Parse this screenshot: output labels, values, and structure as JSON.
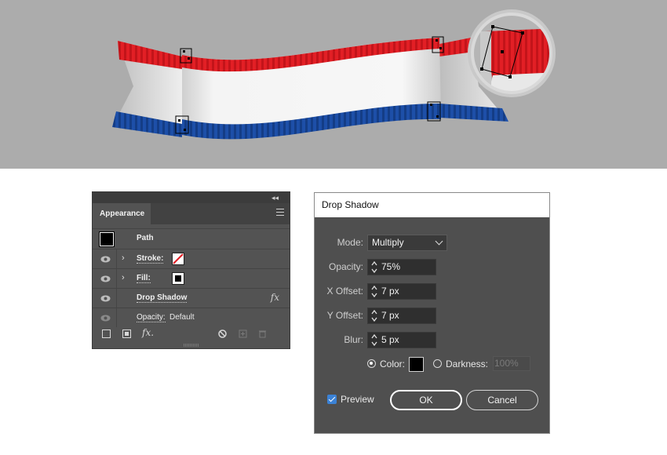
{
  "appearance": {
    "tab_label": "Appearance",
    "path_label": "Path",
    "stroke_label": "Stroke:",
    "fill_label": "Fill:",
    "drop_shadow_label": "Drop Shadow",
    "fx_glyph": "fx",
    "opacity_label": "Opacity:",
    "opacity_value": "Default",
    "collapse_glyph": "◂◂",
    "close_glyph": "✕",
    "toolbar_fx": "fx."
  },
  "drop_shadow": {
    "title": "Drop Shadow",
    "mode_label": "Mode:",
    "mode_value": "Multiply",
    "opacity_label": "Opacity:",
    "opacity_value": "75%",
    "x_offset_label": "X Offset:",
    "x_offset_value": "7 px",
    "y_offset_label": "Y Offset:",
    "y_offset_value": "7 px",
    "blur_label": "Blur:",
    "blur_value": "5 px",
    "color_label": "Color:",
    "color_value": "#000000",
    "darkness_label": "Darkness:",
    "darkness_value": "100%",
    "preview_label": "Preview",
    "ok_label": "OK",
    "cancel_label": "Cancel"
  },
  "colors": {
    "ribbon_red": "#e21f25",
    "ribbon_white": "#f4f4f4",
    "ribbon_blue": "#1d4fa8",
    "artboard_bg": "#acacac",
    "panel_bg": "#535353",
    "dialog_bg": "#4f4f4f"
  }
}
